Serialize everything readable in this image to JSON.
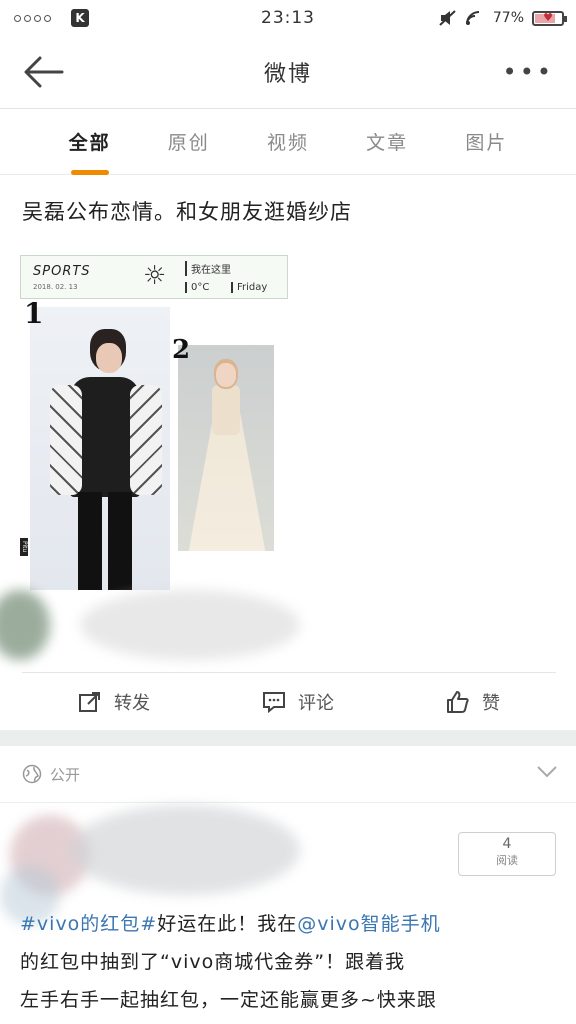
{
  "status_bar": {
    "time": "23:13",
    "battery_percent": "77%",
    "battery_level": 0.77,
    "app_badge": "K"
  },
  "nav": {
    "title": "微博"
  },
  "tabs": [
    {
      "label": "全部",
      "active": true
    },
    {
      "label": "原创",
      "active": false
    },
    {
      "label": "视频",
      "active": false
    },
    {
      "label": "文章",
      "active": false
    },
    {
      "label": "图片",
      "active": false
    }
  ],
  "post": {
    "text": "吴磊公布恋情。和女朋友逛婚纱店",
    "image": {
      "header_sports": "SPORTS",
      "header_date": "2018. 02. 13",
      "header_location": "我在这里",
      "header_temp": "0°C",
      "header_day": "Friday",
      "num_1": "1",
      "num_2": "2",
      "side_tag": "Pitu"
    },
    "actions": {
      "repost": "转发",
      "comment": "评论",
      "like": "赞"
    }
  },
  "post2": {
    "visibility": "公开",
    "reads_count": "4",
    "reads_label": "阅读",
    "text_prefix_tag": "#vivo的红包#",
    "text_tag2": "好运在此！",
    "text_line1_rest": "我在",
    "text_mention": "@vivo智能手机",
    "text_line2": "的红包中抽到了“vivo商城代金券”！跟着我",
    "text_line3": "左手右手一起抽红包，一定还能赢更多~快来跟"
  },
  "colors": {
    "accent": "#f08a00",
    "link": "#3a76b0",
    "separator": "#eceded"
  }
}
